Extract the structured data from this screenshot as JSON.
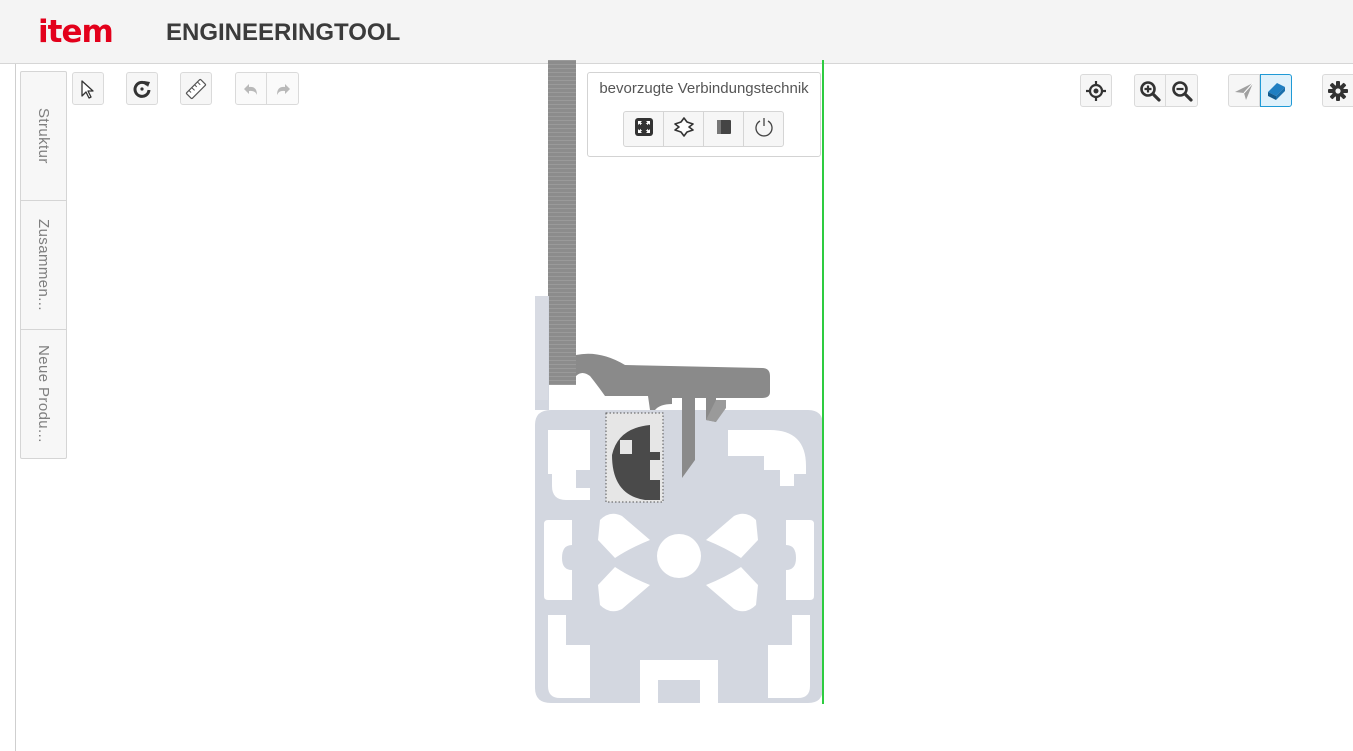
{
  "header": {
    "logo_text": "item",
    "app_title": "ENGINEERINGTOOL",
    "logo_color": "#e3001b"
  },
  "sidebar": {
    "tabs": [
      {
        "label": "Struktur"
      },
      {
        "label": "Zusammen..."
      },
      {
        "label": "Neue Produ..."
      }
    ]
  },
  "toolbar_left": {
    "buttons": [
      {
        "name": "select",
        "icon": "cursor-arrow-icon"
      },
      {
        "name": "rotate",
        "icon": "rotate-refresh-icon"
      },
      {
        "name": "measure",
        "icon": "ruler-icon"
      },
      {
        "name": "undo",
        "icon": "undo-arrow-icon",
        "enabled": false
      },
      {
        "name": "redo",
        "icon": "redo-arrow-icon",
        "enabled": false
      }
    ]
  },
  "connection_panel": {
    "title": "bevorzugte Verbindungstechnik",
    "buttons": [
      {
        "name": "automatic",
        "icon": "expand-arrows-icon"
      },
      {
        "name": "universal",
        "icon": "profile-outline-icon"
      },
      {
        "name": "standard",
        "icon": "filled-square-icon"
      },
      {
        "name": "power",
        "icon": "power-icon"
      }
    ]
  },
  "toolbar_right": {
    "buttons": [
      {
        "name": "center",
        "icon": "crosshair-icon"
      },
      {
        "name": "zoom-in",
        "icon": "zoom-in-icon"
      },
      {
        "name": "zoom-out",
        "icon": "zoom-out-icon"
      },
      {
        "name": "view-2d",
        "icon": "paper-plane-icon"
      },
      {
        "name": "view-3d",
        "icon": "cube-icon",
        "active": true
      },
      {
        "name": "settings",
        "icon": "gear-icon"
      }
    ]
  },
  "viewport": {
    "profile_color": "#d3d7e0",
    "part_color": "#8a8a8a",
    "axis_y_color": "#2ecc40",
    "axis_x_color": "#f05a28"
  }
}
